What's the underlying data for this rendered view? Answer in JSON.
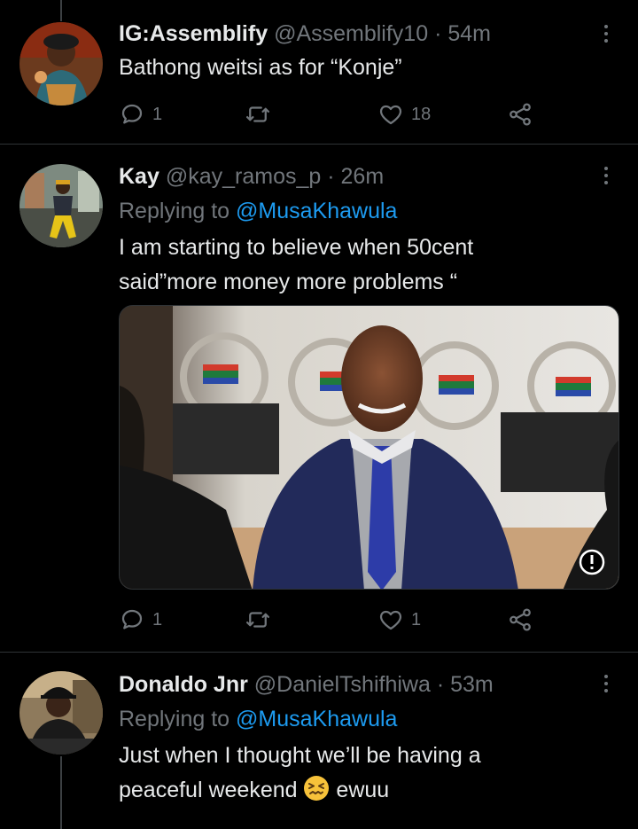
{
  "tweets": [
    {
      "display_name": "IG:Assemblify",
      "handle": "@Assemblify10",
      "separator": "·",
      "time": "54m",
      "lines": [
        "Bathong weitsi as for “Konje”"
      ],
      "reply_count": "1",
      "retweet_count": "",
      "like_count": "18"
    },
    {
      "display_name": "Kay",
      "handle": "@kay_ramos_p",
      "separator": "·",
      "time": "26m",
      "replying_prefix": "Replying to ",
      "replying_to": "@MusaKhawula",
      "lines": [
        "I am starting to believe when 50cent",
        "said”more money more problems “"
      ],
      "reply_count": "1",
      "retweet_count": "",
      "like_count": "1"
    },
    {
      "display_name": "Donaldo Jnr",
      "handle": "@DanielTshifhiwa",
      "separator": "·",
      "time": "53m",
      "replying_prefix": "Replying to ",
      "replying_to": "@MusaKhawula",
      "lines": [
        "Just when I thought we’ll be having a",
        "peaceful weekend "
      ],
      "line2_suffix": " ewuu"
    }
  ],
  "icons": {
    "reply": "reply-icon",
    "retweet": "retweet-icon",
    "like": "heart-icon",
    "share": "share-icon",
    "more": "more-options-icon",
    "emoji": "confounded-face-emoji"
  },
  "colors": {
    "background": "#000000",
    "text": "#e7e9ea",
    "muted": "#71767b",
    "link": "#1d9bf0",
    "divider": "#2f3336"
  }
}
